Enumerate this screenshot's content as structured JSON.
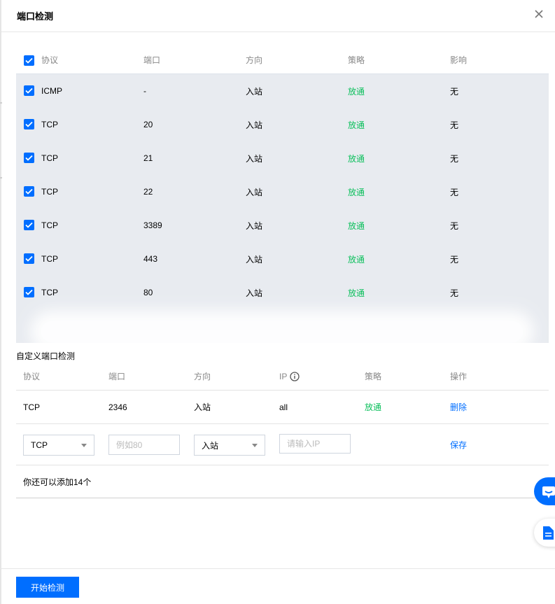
{
  "dialog": {
    "title": "端口检测"
  },
  "ports_table": {
    "columns": [
      "协议",
      "端口",
      "方向",
      "策略",
      "影响"
    ],
    "rows": [
      {
        "protocol": "ICMP",
        "port": "-",
        "direction": "入站",
        "policy": "放通",
        "impact": "无",
        "checked": true
      },
      {
        "protocol": "TCP",
        "port": "20",
        "direction": "入站",
        "policy": "放通",
        "impact": "无",
        "checked": true
      },
      {
        "protocol": "TCP",
        "port": "21",
        "direction": "入站",
        "policy": "放通",
        "impact": "无",
        "checked": true
      },
      {
        "protocol": "TCP",
        "port": "22",
        "direction": "入站",
        "policy": "放通",
        "impact": "无",
        "checked": true
      },
      {
        "protocol": "TCP",
        "port": "3389",
        "direction": "入站",
        "policy": "放通",
        "impact": "无",
        "checked": true
      },
      {
        "protocol": "TCP",
        "port": "443",
        "direction": "入站",
        "policy": "放通",
        "impact": "无",
        "checked": true
      },
      {
        "protocol": "TCP",
        "port": "80",
        "direction": "入站",
        "policy": "放通",
        "impact": "无",
        "checked": true
      }
    ]
  },
  "custom": {
    "title": "自定义端口检测",
    "columns": [
      "协议",
      "端口",
      "方向",
      "IP",
      "策略",
      "操作"
    ],
    "row": {
      "protocol": "TCP",
      "port": "2346",
      "direction": "入站",
      "ip": "all",
      "policy": "放通",
      "action": "删除"
    },
    "edit": {
      "protocol_value": "TCP",
      "port_placeholder": "例如80",
      "direction_value": "入站",
      "ip_placeholder": "请输入IP",
      "save_label": "保存"
    },
    "hint": "你还可以添加14个"
  },
  "footer": {
    "start_label": "开始检测"
  },
  "colors": {
    "primary": "#006eff",
    "success": "#0abf5b",
    "table_body_bg": "#e8ebf0"
  },
  "icons": [
    "close-icon",
    "checkbox-checked-icon",
    "info-icon",
    "caret-down-icon",
    "chat-icon",
    "document-icon"
  ]
}
